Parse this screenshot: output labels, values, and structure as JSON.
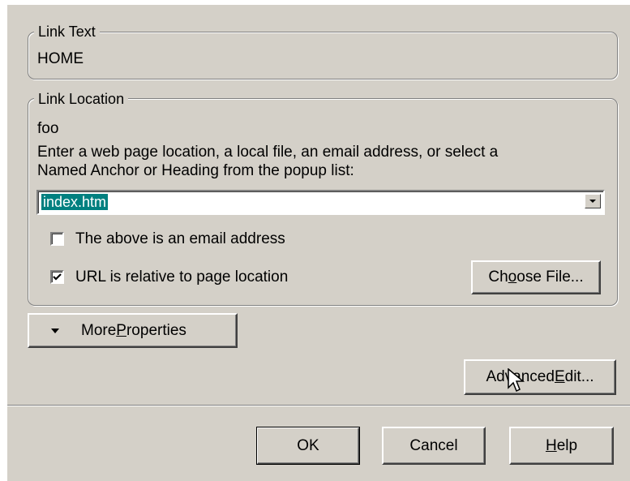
{
  "link_text_group": {
    "legend": "Link Text",
    "value": "HOME"
  },
  "link_location_group": {
    "legend": "Link Location",
    "current_value": "foo",
    "instructions_line1": "Enter a web page location, a local file, an email address, or select a",
    "instructions_line2": "Named Anchor or Heading from the popup list:",
    "url_value": "index.htm",
    "email_checkbox": {
      "label": "The above is an email address",
      "checked": false
    },
    "relative_checkbox": {
      "label": "URL is relative to page location",
      "checked": true
    },
    "choose_file_button": {
      "pre": "Ch",
      "accel": "o",
      "post": "ose File..."
    }
  },
  "more_properties_button": {
    "pre": "More ",
    "accel": "P",
    "post": "roperties"
  },
  "advanced_edit_button": {
    "pre": "Advanced ",
    "accel": "E",
    "post": "dit..."
  },
  "footer": {
    "ok": "OK",
    "cancel": "Cancel",
    "help": {
      "pre": "",
      "accel": "H",
      "post": "elp"
    }
  },
  "icons": {
    "dropdown_arrow": "triangle-down-icon",
    "more_arrow": "triangle-down-icon",
    "check_mark": "checkmark-icon",
    "cursor": "mouse-pointer-icon"
  },
  "colors": {
    "dialog_bg": "#d4d0c8",
    "selection_bg": "#008080",
    "field_bg": "#ffffff"
  }
}
